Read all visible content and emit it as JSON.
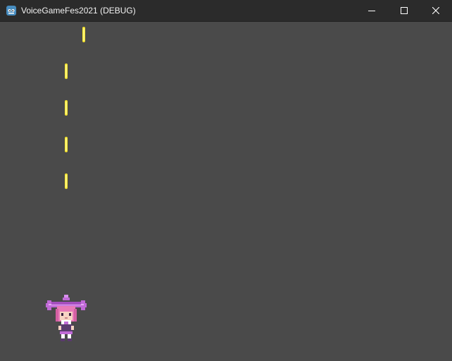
{
  "window": {
    "title": "VoiceGameFes2021 (DEBUG)",
    "app_icon": "godot-engine-icon",
    "controls": {
      "minimize_icon": "minimize-icon",
      "maximize_icon": "maximize-icon",
      "close_icon": "close-icon"
    }
  },
  "game": {
    "background_color": "#4a4a4a",
    "bullet_color": "#f5e431",
    "bullet_count": 5,
    "player": {
      "sprite": "pink-haired-girl-on-purple-winged-ship",
      "primary_color": "#c06ad6",
      "hair_color": "#e87ab8"
    }
  }
}
